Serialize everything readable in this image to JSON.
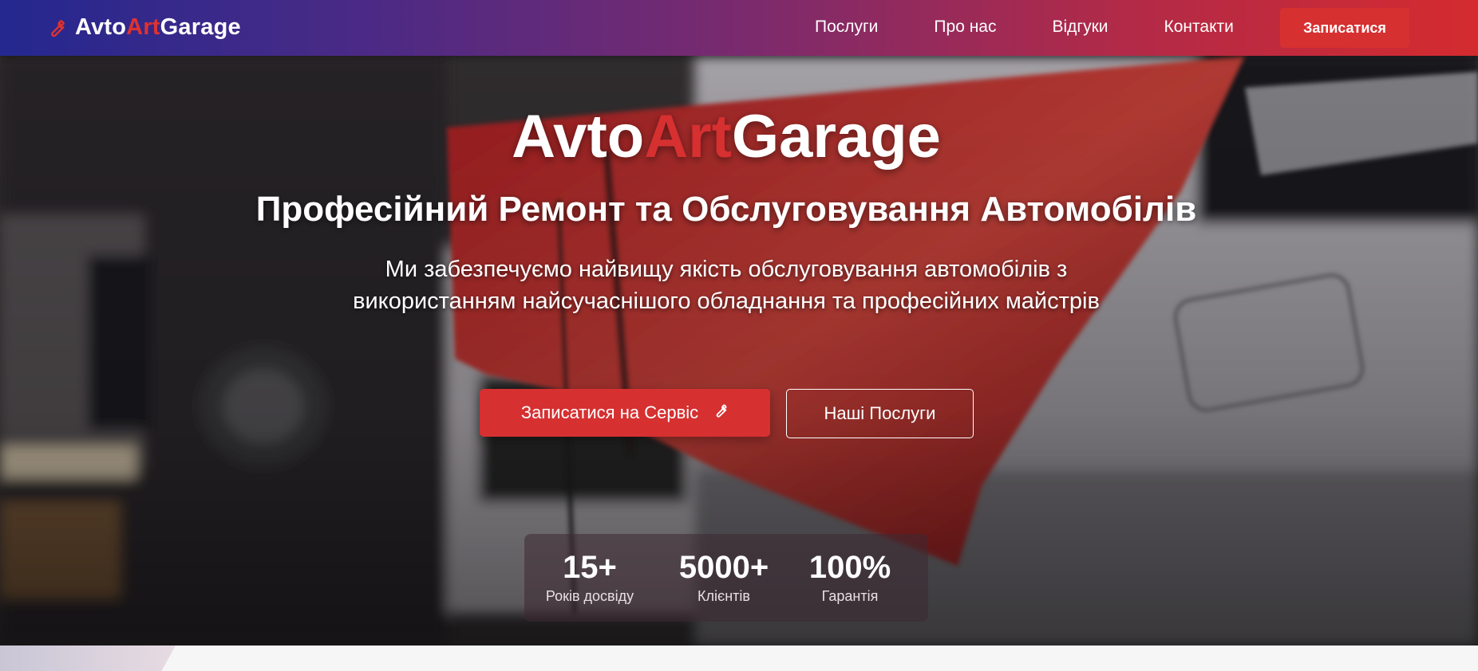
{
  "nav": {
    "brand": {
      "part1": "Avto",
      "part2": "Art",
      "part3": "Garage"
    },
    "links": [
      "Послуги",
      "Про нас",
      "Відгуки",
      "Контакти"
    ],
    "cta": "Записатися"
  },
  "hero": {
    "title": {
      "part1": "Avto",
      "part2": "Art",
      "part3": "Garage"
    },
    "subtitle": "Професійний Ремонт та Обслуговування Автомобілів",
    "description": "Ми забезпечуємо найвищу якість обслуговування автомобілів з використанням найсучаснішого обладнання та професійних майстрів",
    "primary_button": "Записатися на Сервіс",
    "secondary_button": "Наші Послуги",
    "stats": [
      {
        "value": "15+",
        "label": "Років досвіду"
      },
      {
        "value": "5000+",
        "label": "Клієнтів"
      },
      {
        "value": "100%",
        "label": "Гарантія"
      }
    ]
  },
  "icons": {
    "brand": "wrench-icon",
    "primary_button": "wrench-icon"
  },
  "colors": {
    "accent": "#d63031",
    "nav_gradient_start": "#24288f",
    "nav_gradient_end": "#d42b2f"
  }
}
